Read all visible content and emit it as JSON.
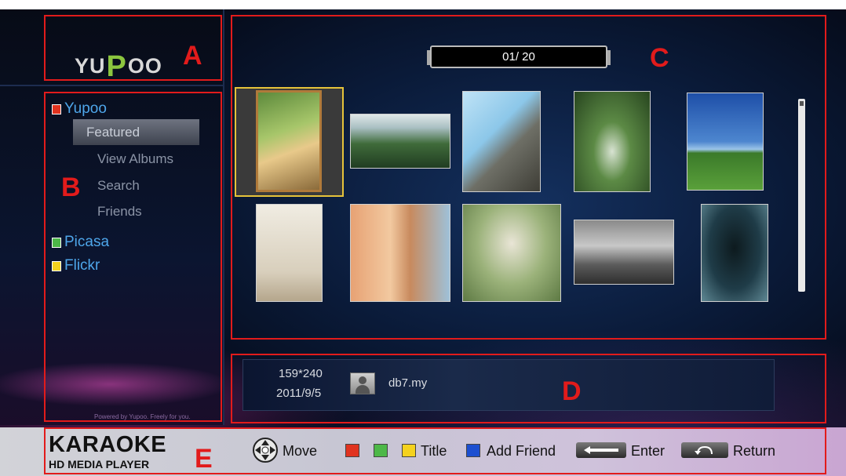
{
  "callouts": {
    "a": "A",
    "b": "B",
    "c": "C",
    "d": "D",
    "e": "E"
  },
  "logo": {
    "pre": "YU",
    "p": "P",
    "post": "OO"
  },
  "sidebar": {
    "sources": [
      {
        "label": "Yupoo",
        "color": "#e0331f"
      },
      {
        "label": "Picasa",
        "color": "#4db848"
      },
      {
        "label": "Flickr",
        "color": "#f4d21e"
      }
    ],
    "yupoo_items": [
      "Featured",
      "View Albums",
      "Search",
      "Friends"
    ],
    "selected_item": "Featured",
    "powered_by": "Powered by Yupoo. Freely for you."
  },
  "gallery": {
    "page_indicator": "01/ 20",
    "thumbnails": [
      "white-dog",
      "valley-landscape",
      "tree-stone-wall",
      "woman-in-forest",
      "stonehenge",
      "boy-jumping",
      "colorful-building-flowers",
      "girl-on-swing",
      "bw-street-people",
      "black-cat"
    ]
  },
  "info": {
    "dimensions": "159*240",
    "date": "2011/9/5",
    "user": "db7.my"
  },
  "footer": {
    "brand_title": "KARAOKE",
    "brand_subtitle": "HD MEDIA PLAYER",
    "move_label": "Move",
    "title_label": "Title",
    "add_friend_label": "Add Friend",
    "enter_label": "Enter",
    "return_label": "Return",
    "key_colors": {
      "red": "#e0331f",
      "green": "#4db848",
      "yellow": "#f4d21e",
      "blue": "#1c4fd0"
    }
  }
}
